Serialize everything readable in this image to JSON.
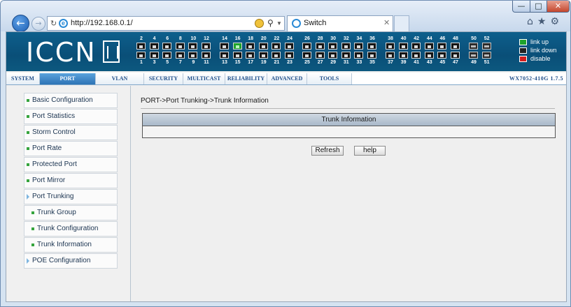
{
  "browser": {
    "url": "http://192.168.0.1/",
    "tab_title": "Switch",
    "window_controls": {
      "minimize": "—",
      "maximize": "□",
      "close": "✕"
    },
    "toolbar_icons": "⌂★⚙"
  },
  "device": {
    "logo": "ICCN",
    "port_top_labels": [
      "2",
      "4",
      "6",
      "8",
      "10",
      "12",
      "14",
      "16",
      "18",
      "20",
      "22",
      "24",
      "26",
      "28",
      "30",
      "32",
      "34",
      "36",
      "38",
      "40",
      "42",
      "44",
      "46",
      "48",
      "50",
      "52"
    ],
    "port_bottom_labels": [
      "1",
      "3",
      "5",
      "7",
      "9",
      "11",
      "13",
      "15",
      "17",
      "19",
      "21",
      "23",
      "25",
      "27",
      "29",
      "31",
      "33",
      "35",
      "37",
      "39",
      "41",
      "43",
      "45",
      "47",
      "49",
      "51"
    ],
    "ports_up": [
      "16"
    ],
    "fiber_ports": [
      "49",
      "50",
      "51",
      "52"
    ],
    "legend": {
      "up": "link up",
      "down": "link down",
      "disable": "disable"
    },
    "colors": {
      "link_up": "#1ea32c",
      "link_down": "#222222",
      "disable": "#d31e1e",
      "banner": "#0d5f8c"
    }
  },
  "nav": {
    "tabs": [
      "SYSTEM",
      "PORT",
      "VLAN",
      "SECURITY",
      "MULTICAST",
      "RELIABILITY",
      "ADVANCED",
      "TOOLS"
    ],
    "active": "PORT",
    "version": "WX7052-410G 1.7.5"
  },
  "sidebar": {
    "items": [
      {
        "label": "Basic Configuration"
      },
      {
        "label": "Port Statistics"
      },
      {
        "label": "Storm Control"
      },
      {
        "label": "Port Rate"
      },
      {
        "label": "Protected Port"
      },
      {
        "label": "Port Mirror"
      },
      {
        "label": "Port Trunking"
      },
      {
        "label": "Trunk Group"
      },
      {
        "label": "Trunk Configuration"
      },
      {
        "label": "Trunk Information"
      },
      {
        "label": "POE Configuration"
      }
    ]
  },
  "main": {
    "breadcrumb": "PORT->Port Trunking->Trunk Information",
    "table_header": "Trunk Information",
    "refresh_label": "Refresh",
    "help_label": "help"
  }
}
